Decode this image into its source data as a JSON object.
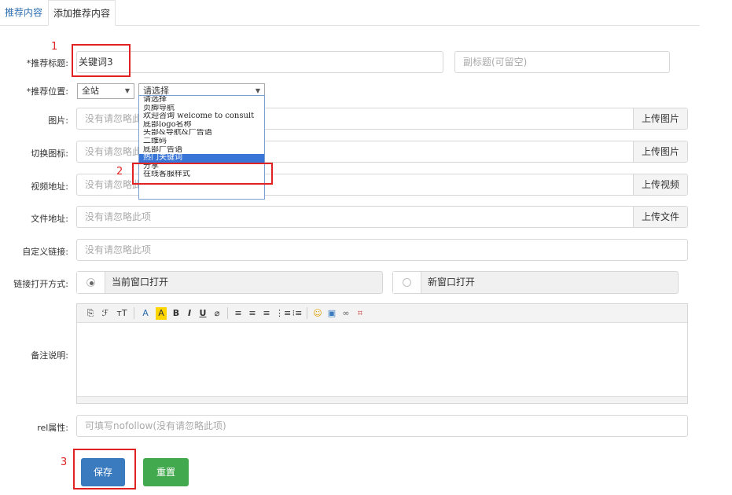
{
  "tabs": [
    {
      "label": "推荐内容"
    },
    {
      "label": "添加推荐内容"
    }
  ],
  "form": {
    "title_label": "*推荐标题:",
    "title_value": "关键词3",
    "subtitle_placeholder": "副标题(可留空)",
    "position_label": "*推荐位置:",
    "position_site": "全站",
    "position_select": "请选择",
    "position_options": [
      "请选择",
      "页脚导航",
      "欢迎咨询 welcome to consult",
      "底部logo名称",
      "头部&导航&广告语",
      "二维码",
      "底部广告语",
      "热门关键词",
      "分享",
      "在线客服样式"
    ],
    "image_label": "图片:",
    "image_placeholder": "没有请忽略此项",
    "image_upload": "上传图片",
    "icon_label": "切换图标:",
    "icon_placeholder": "没有请忽略此项",
    "icon_upload": "上传图片",
    "video_label": "视频地址:",
    "video_placeholder": "没有请忽略此项",
    "video_upload": "上传视频",
    "file_label": "文件地址:",
    "file_placeholder": "没有请忽略此项",
    "file_upload": "上传文件",
    "link_label": "自定义链接:",
    "link_placeholder": "没有请忽略此项",
    "open_label": "链接打开方式:",
    "open_current": "当前窗口打开",
    "open_new": "新窗口打开",
    "note_label": "备注说明:",
    "rel_label": "rel属性:",
    "rel_placeholder": "可填写nofollow(没有请忽略此项)"
  },
  "editor_toolbar": [
    "⎘",
    "ℱ",
    "тT",
    "A",
    "A",
    "B",
    "I",
    "U",
    "⌀",
    "≡",
    "≡",
    "≡",
    "⋮≡",
    "⁝≡",
    "☺",
    "▣",
    "∞",
    "⌗"
  ],
  "buttons": {
    "save": "保存",
    "reset": "重置"
  },
  "annotations": [
    "1",
    "2",
    "3"
  ],
  "colors": {
    "accent_blue": "#3a7bbf",
    "reset_green": "#43a94e",
    "annotation_red": "#e02222",
    "selected_option": "#3875d7"
  }
}
